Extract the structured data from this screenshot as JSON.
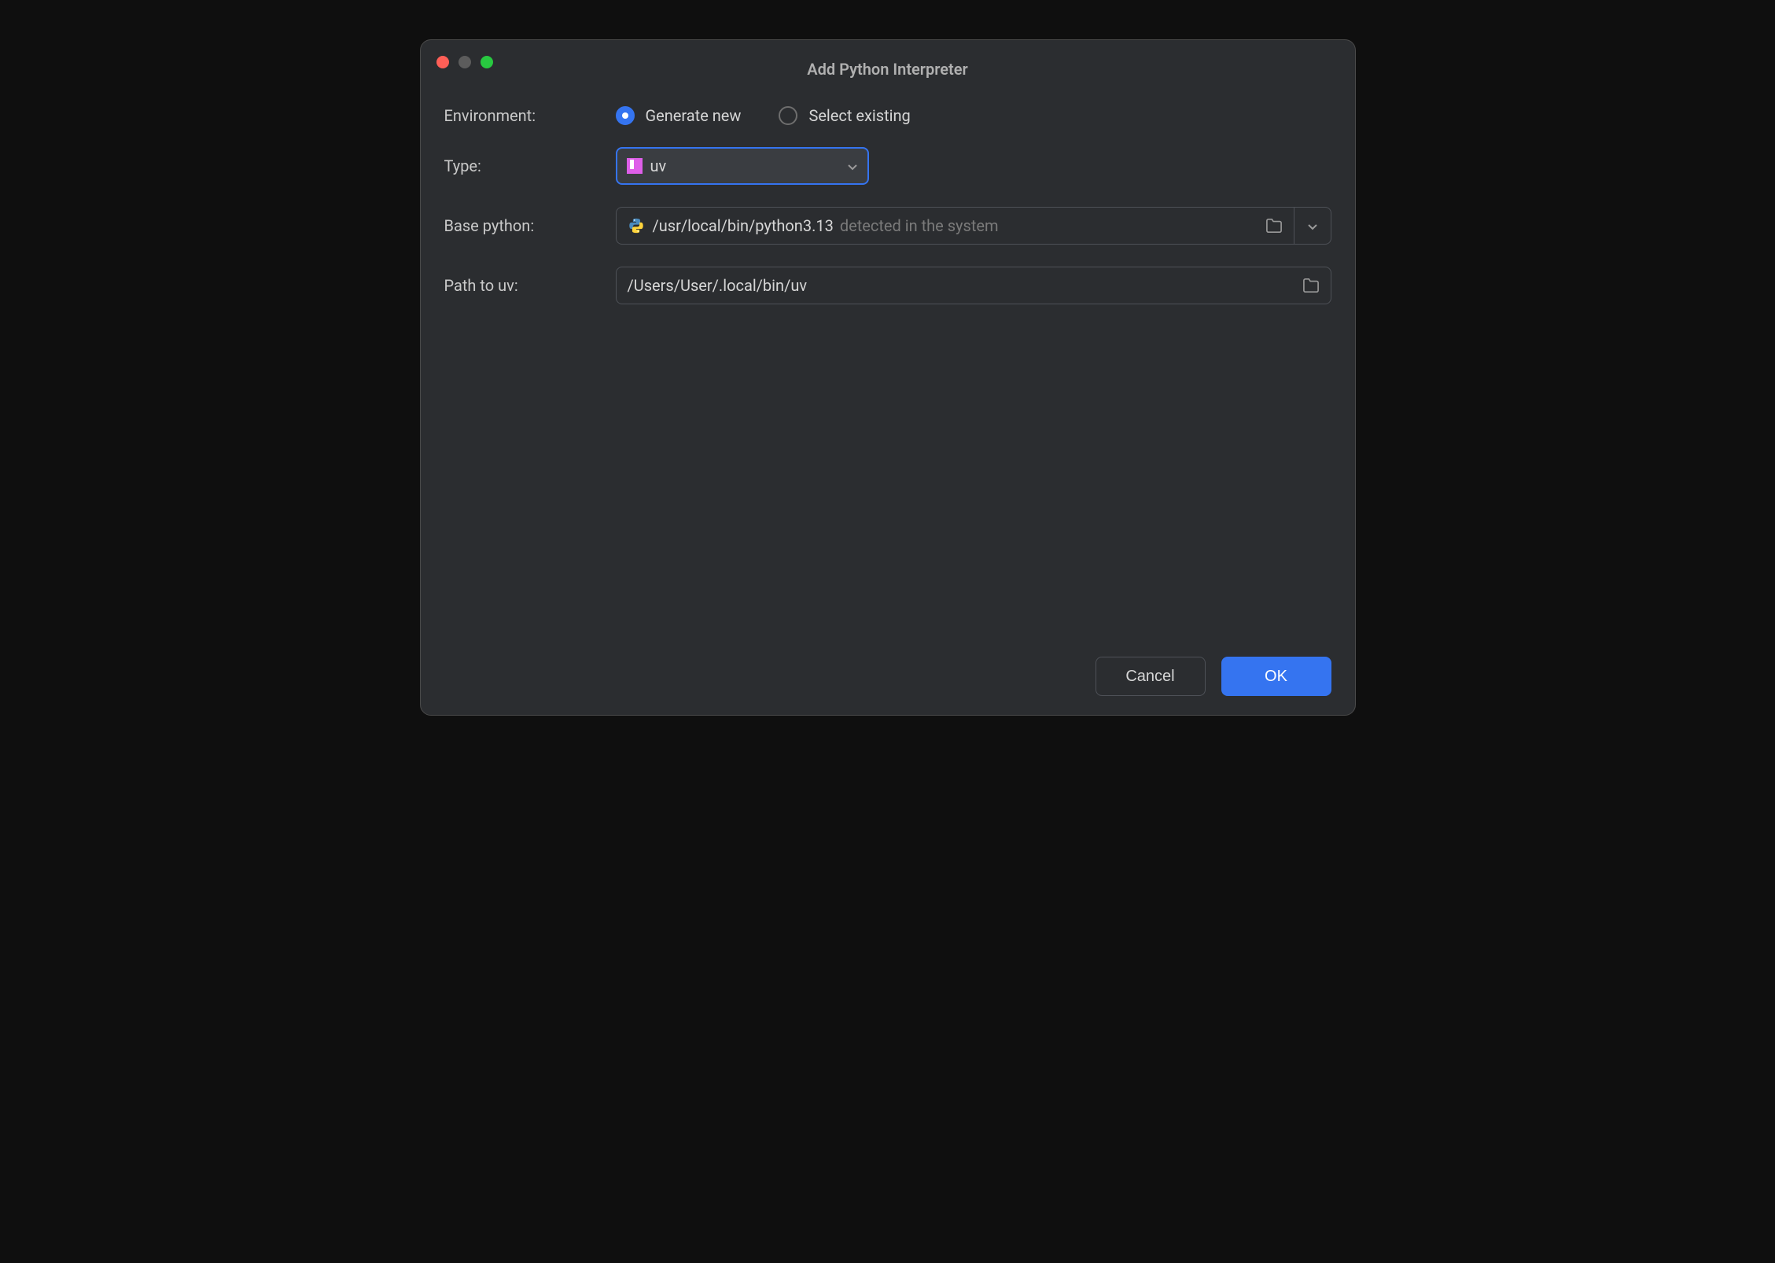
{
  "dialog": {
    "title": "Add Python Interpreter"
  },
  "environment": {
    "label": "Environment:",
    "generate_new_label": "Generate new",
    "select_existing_label": "Select existing",
    "selected": "generate_new"
  },
  "type": {
    "label": "Type:",
    "selected_value": "uv",
    "icon_name": "uv-icon"
  },
  "base_python": {
    "label": "Base python:",
    "value": "/usr/local/bin/python3.13",
    "hint": "detected in the system",
    "icon_name": "python-icon"
  },
  "path_to_uv": {
    "label": "Path to uv:",
    "value": "/Users/User/.local/bin/uv"
  },
  "buttons": {
    "cancel": "Cancel",
    "ok": "OK"
  }
}
